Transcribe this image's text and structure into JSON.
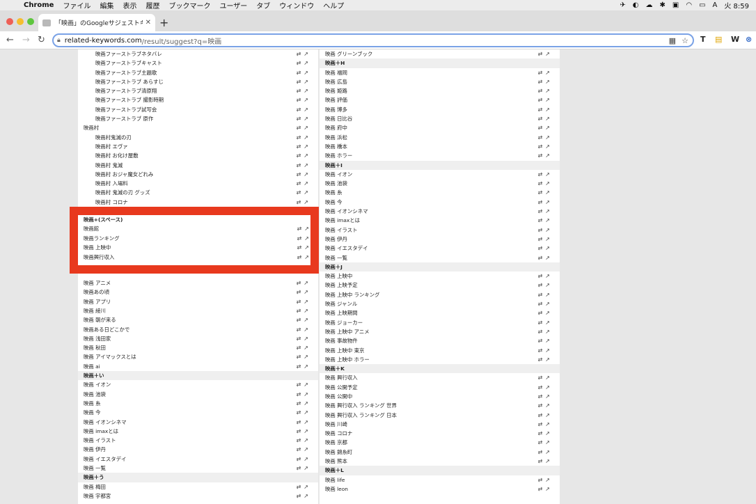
{
  "menubar": {
    "app": "Chrome",
    "items": [
      "ファイル",
      "編集",
      "表示",
      "履歴",
      "ブックマーク",
      "ユーザー",
      "タブ",
      "ウィンドウ",
      "ヘルプ"
    ],
    "clock": "火 8:59"
  },
  "tab": {
    "title": "「映画」のGoogleサジェストキー"
  },
  "omnibox": {
    "host": "related-keywords.com",
    "path": "/result/suggest?q=映画"
  },
  "extensions": [
    "T",
    "W"
  ],
  "column1": {
    "rows_top": [
      {
        "t": "映画ファーストラブネタバレ",
        "sub": true
      },
      {
        "t": "映画ファーストラブキャスト",
        "sub": true
      },
      {
        "t": "映画ファーストラブ主題歌",
        "sub": true
      },
      {
        "t": "映画ファーストラブ あらすじ",
        "sub": true
      },
      {
        "t": "映画ファーストラブ清原翔",
        "sub": true
      },
      {
        "t": "映画ファーストラブ 撮影時期",
        "sub": true
      },
      {
        "t": "映画ファーストラブ試写会",
        "sub": true
      },
      {
        "t": "映画ファーストラブ 原作",
        "sub": true
      },
      {
        "t": "映画村",
        "sub": false
      },
      {
        "t": "映画村鬼滅の刃",
        "sub": true
      },
      {
        "t": "映画村 エヴァ",
        "sub": true
      },
      {
        "t": "映画村 お化け屋敷",
        "sub": true
      },
      {
        "t": "映画村 鬼滅",
        "sub": true
      },
      {
        "t": "映画村 おジャ魔女どれみ",
        "sub": true
      },
      {
        "t": "映画村 入場料",
        "sub": true
      },
      {
        "t": "映画村 鬼滅の刃 グッズ",
        "sub": true
      },
      {
        "t": "映画村 コロナ",
        "sub": true
      }
    ],
    "highlight_header": "映画+(スペース)",
    "highlight_rows": [
      "映画館",
      "映画ランキング",
      "映画 上映中",
      "映画興行収入"
    ],
    "rows_a": [
      "映画 アニメ",
      "映画あの頃",
      "映画 アプリ",
      "映画 綾川",
      "映画 朝が来る",
      "映画ある日どこかで",
      "映画 浅田家",
      "映画 秋田",
      "映画 アイマックスとは",
      "映画 ai"
    ],
    "header_i": "映画＋い",
    "rows_i": [
      "映画 イオン",
      "映画 池袋",
      "映画 糸",
      "映画 今",
      "映画 イオンシネマ",
      "映画 imaxとは",
      "映画 イラスト",
      "映画 伊丹",
      "映画 イエスタデイ",
      "映画 一覧"
    ],
    "header_u": "映画＋う",
    "rows_u": [
      "映画 梅田",
      "映画 宇都宮"
    ]
  },
  "column2": {
    "rows_g": [
      "映画 グリーンブック"
    ],
    "header_h": "映画＋H",
    "rows_h": [
      "映画 福岡",
      "映画 広島",
      "映画 姫路",
      "映画 評価",
      "映画 博多",
      "映画 日比谷",
      "映画 府中",
      "映画 浜松",
      "映画 橋本",
      "映画 ホラー"
    ],
    "header_i": "映画＋I",
    "rows_i": [
      "映画 イオン",
      "映画 池袋",
      "映画 糸",
      "映画 今",
      "映画 イオンシネマ",
      "映画 imaxとは",
      "映画 イラスト",
      "映画 伊丹",
      "映画 イエスタデイ",
      "映画 一覧"
    ],
    "header_j": "映画＋J",
    "rows_j": [
      "映画 上映中",
      "映画 上映予定",
      "映画 上映中 ランキング",
      "映画 ジャンル",
      "映画 上映期間",
      "映画 ジョーカー",
      "映画 上映中 アニメ",
      "映画 事故物件",
      "映画 上映中 東京",
      "映画 上映中 ホラー"
    ],
    "header_k": "映画＋K",
    "rows_k": [
      "映画 興行収入",
      "映画 公開予定",
      "映画 公開中",
      "映画 興行収入 ランキング 世界",
      "映画 興行収入 ランキング 日本",
      "映画 川崎",
      "映画 コロナ",
      "映画 京都",
      "映画 錦糸町",
      "映画 熊本"
    ],
    "header_l": "映画＋L",
    "rows_l": [
      "映画 life",
      "映画 leon"
    ]
  }
}
